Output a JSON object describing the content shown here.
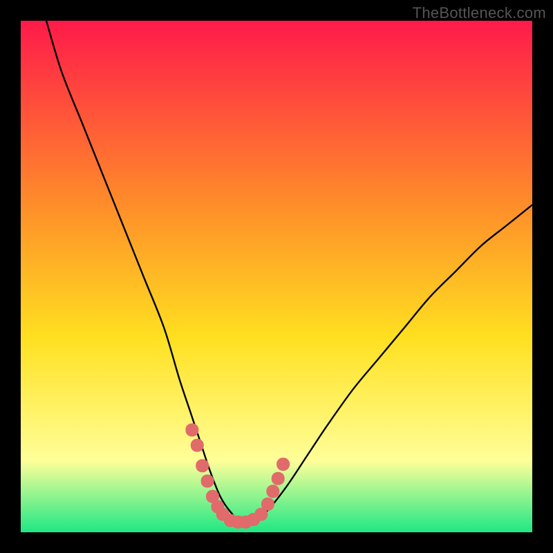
{
  "watermark": "TheBottleneck.com",
  "colors": {
    "page_bg": "#000000",
    "gradient_top": "#ff1a4a",
    "gradient_mid_upper": "#ff8a2a",
    "gradient_mid": "#ffe020",
    "gradient_lower": "#ffff99",
    "gradient_bottom": "#1ee884",
    "curve": "#000000",
    "marker": "#e16a6b"
  },
  "chart_data": {
    "type": "line",
    "title": "",
    "xlabel": "",
    "ylabel": "",
    "xlim": [
      0,
      100
    ],
    "ylim": [
      0,
      100
    ],
    "grid": false,
    "legend": false,
    "series": [
      {
        "name": "bottleneck-curve",
        "x": [
          5,
          8,
          12,
          16,
          20,
          24,
          28,
          31,
          33,
          35,
          37,
          39,
          41,
          43,
          45,
          48,
          52,
          56,
          60,
          65,
          70,
          75,
          80,
          85,
          90,
          95,
          100
        ],
        "y": [
          100,
          90,
          80,
          70,
          60,
          50,
          40,
          30,
          24,
          18,
          12,
          7,
          4,
          2,
          2,
          4,
          9,
          15,
          21,
          28,
          34,
          40,
          46,
          51,
          56,
          60,
          64
        ]
      }
    ],
    "markers": [
      {
        "x": 33.5,
        "y": 20
      },
      {
        "x": 34.5,
        "y": 17
      },
      {
        "x": 35.5,
        "y": 13
      },
      {
        "x": 36.5,
        "y": 10
      },
      {
        "x": 37.5,
        "y": 7
      },
      {
        "x": 38.5,
        "y": 5
      },
      {
        "x": 39.5,
        "y": 3.5
      },
      {
        "x": 41.0,
        "y": 2.3
      },
      {
        "x": 42.5,
        "y": 2.0
      },
      {
        "x": 44.0,
        "y": 2.0
      },
      {
        "x": 45.5,
        "y": 2.5
      },
      {
        "x": 47.0,
        "y": 3.5
      },
      {
        "x": 48.3,
        "y": 5.5
      },
      {
        "x": 49.3,
        "y": 8.0
      },
      {
        "x": 50.3,
        "y": 10.5
      },
      {
        "x": 51.3,
        "y": 13.3
      }
    ]
  }
}
